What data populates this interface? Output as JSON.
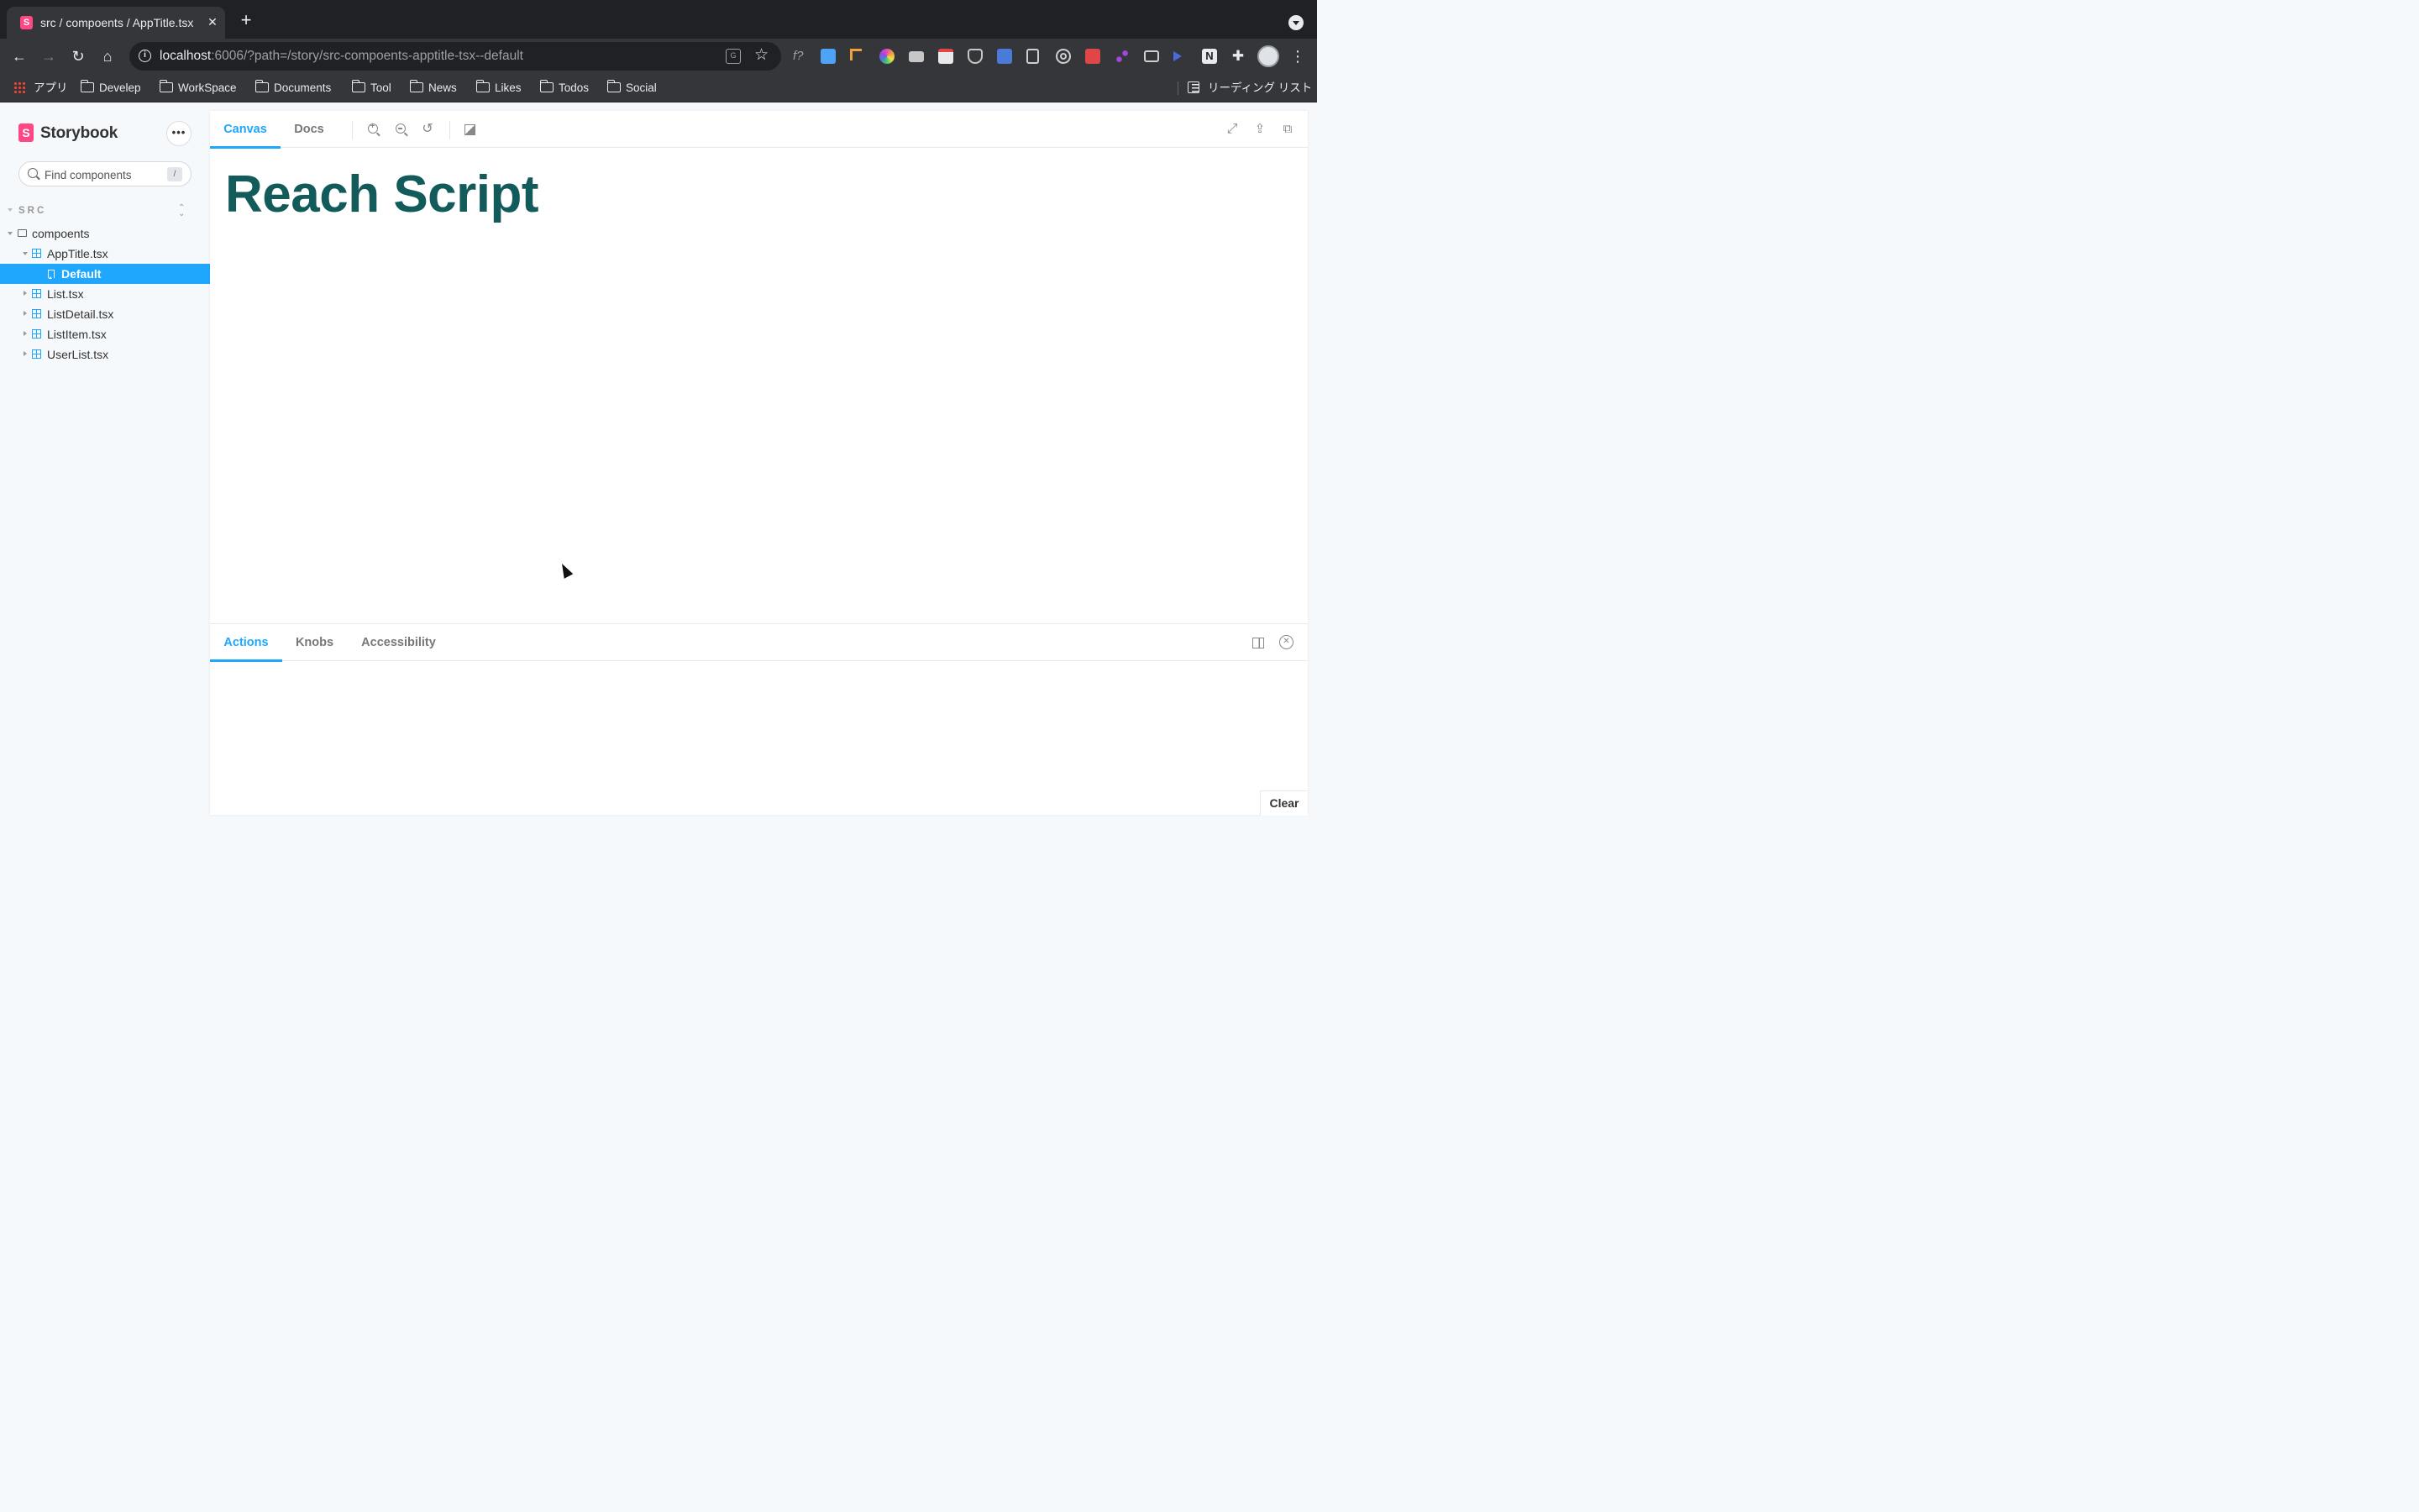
{
  "browser": {
    "tab_title": "src / compoents / AppTitle.tsx",
    "favicon_letter": "S",
    "url_host": "localhost",
    "url_rest": ":6006/?path=/story/src-compoents-apptitle-tsx--default",
    "bookmarks": [
      "アプリ",
      "Develep",
      "WorkSpace",
      "Documents",
      "Tool",
      "News",
      "Likes",
      "Todos",
      "Social"
    ],
    "reading_list": "リーディング リスト",
    "extension_colors": [
      "#4fa3f7",
      "#f0a13b",
      "#e64bbd",
      "#c7c7c7",
      "#e9e9e9",
      "#c7c7c7",
      "#4a7bd9",
      "#cfcfcf",
      "#cfcfcf",
      "#e04646",
      "#a146e0",
      "#cfcfcf",
      "#4a6bd9",
      "#e8eaed"
    ]
  },
  "sidebar": {
    "brand": "Storybook",
    "logo_letter": "S",
    "menu_label": "•••",
    "search_placeholder": "Find components",
    "search_shortcut": "/",
    "root_label": "SRC",
    "tree": {
      "folder": "compoents",
      "component_open": "AppTitle.tsx",
      "story_selected": "Default",
      "components": [
        "List.tsx",
        "ListDetail.tsx",
        "ListItem.tsx",
        "UserList.tsx"
      ]
    }
  },
  "canvas": {
    "tabs": [
      "Canvas",
      "Docs"
    ],
    "active_tab": "Canvas",
    "story_text": "Reach Script"
  },
  "addons": {
    "tabs": [
      "Actions",
      "Knobs",
      "Accessibility"
    ],
    "active_tab": "Actions",
    "clear_label": "Clear"
  },
  "colors": {
    "accent": "#1ea7fd",
    "storybook_pink": "#ff4785",
    "story_text": "#135b5b"
  }
}
